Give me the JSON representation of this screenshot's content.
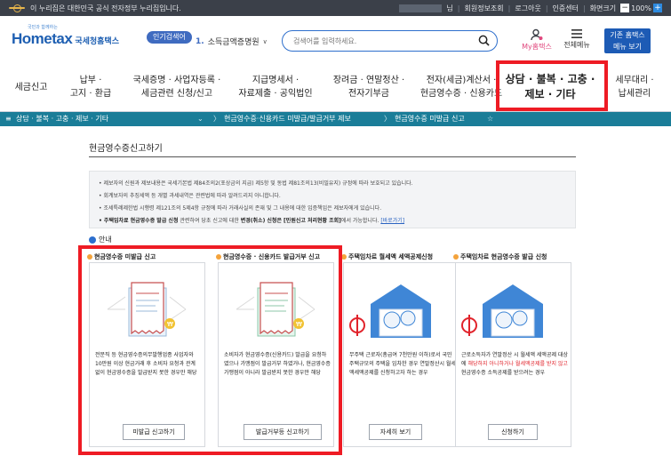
{
  "topbar": {
    "notice": "이 누리집은 대한민국 공식 전자정부 누리집입니다.",
    "user_suffix": "님",
    "links": [
      "회원정보조회",
      "로그아웃",
      "인증센터",
      "화면크기"
    ],
    "zoom": "100%"
  },
  "header": {
    "logo_sub": "국민과 함께하는",
    "logo_hometax": "Hometax",
    "logo_kr": "국세청홈택스",
    "popular_badge": "인기검색어",
    "popular_rank": "1.",
    "popular_word": "소득금액증명원",
    "search_placeholder": "검색어를 입력하세요.",
    "mytax": "My홈택스",
    "allmenu": "전체메뉴",
    "oldhome_line1": "기존 홈택스",
    "oldhome_line2": "메뉴 보기"
  },
  "gnb": [
    {
      "l1": "세금신고",
      "l2": ""
    },
    {
      "l1": "납부 ·",
      "l2": "고지 · 환급"
    },
    {
      "l1": "국세증명 · 사업자등록 ·",
      "l2": "세금관련 신청/신고"
    },
    {
      "l1": "지급명세서 ·",
      "l2": "자료제출 · 공익법인"
    },
    {
      "l1": "장려금 · 연말정산 ·",
      "l2": "전자기부금"
    },
    {
      "l1": "전자(세금)계산서 ·",
      "l2": "현금영수증 · 신용카드"
    },
    {
      "l1": "상담 · 불복 · 고충 ·",
      "l2": "제보 · 기타"
    },
    {
      "l1": "세무대리 ·",
      "l2": "납세관리"
    }
  ],
  "subnav": {
    "menu": "상담 · 불복 · 고충 · 제보 · 기타",
    "crumb1": "현금영수증·신용카드 미발급/발급거부 제보",
    "crumb2": "현금영수증 미발급 신고"
  },
  "content": {
    "page_title": "현금영수증신고하기",
    "info": [
      "• 제보자의 신원과 제보내용은 국세기본법 제84조의2(포상금의 지급) 제5항 및 동법 제81조의13(비밀유지) 규정에 따라 보호되고 있습니다.",
      "• 회계보자의 추징세액 등 개별 과세내역은 관련법에 따라 알려드리지 아니합니다.",
      "• 조세특례제한법 시행령 제121조의 5제4항 규정에 따라 거래사실의 존재 및 그 내용에 대한 입증책임은 제보자에게 있습니다."
    ],
    "info4_bold": "• 주택임차료 현금영수증 발급 신청",
    "info4_mid": " 관련하여 당초 신고에 대한 ",
    "info4_bold2": "변경(취소) 신청은 [민원신고 처리현황 조회]",
    "info4_end": "에서 가능합니다.",
    "info4_link": "[바로가기]",
    "guide": "안내"
  },
  "cards": [
    {
      "title": "현금영수증 미발급 신고",
      "desc": "전문직 등 현금영수증의무발행업종 사업자와 10만원 이상 현금거래 후 소비자 요청과 관계 없이 현금영수증을 발급받지 못한 경우만 해당",
      "button": "미발급 신고하기"
    },
    {
      "title": "현금영수증 · 신용카드 발급거부 신고",
      "desc": "소비자가 현금영수증(신용카드) 발급을 요청하였으나 가맹점이 발급거부 하였거나, 현금영수증 가맹점이 아니라 발급받지 못한 경우만 해당",
      "button": "발급거부등 신고하기"
    },
    {
      "title": "주택임차료 월세액 세액공제신청",
      "desc": "무주택 근로자(총급여 7천만원 이하)로서 국민주택규모의 주택을 임차한 경우 연말정산시 월세액세액공제를 신청하고자 하는 경우",
      "button": "자세히 보기"
    },
    {
      "title": "주택임차료 현금영수증 발급 신청",
      "desc_a": "근로소득자가 연말정산 시 월세액 세액공제 대상에 ",
      "desc_red": "해당하지 아니하거나 월세액공제를 받지 않고",
      "desc_b": " 현금영수증 소득공제를 받으려는 경우",
      "button": "신청하기"
    }
  ],
  "colors": {
    "highlight_border": "#ee1b24",
    "subnav_bg": "#1a7d98",
    "topbar_bg": "#3b4049",
    "brand_blue": "#1e5fb2"
  }
}
